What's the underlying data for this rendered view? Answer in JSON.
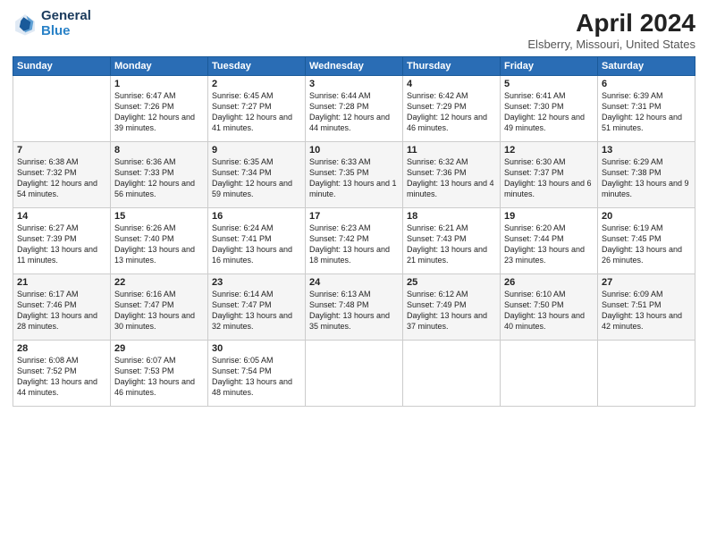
{
  "header": {
    "logo_line1": "General",
    "logo_line2": "Blue",
    "title": "April 2024",
    "location": "Elsberry, Missouri, United States"
  },
  "days_of_week": [
    "Sunday",
    "Monday",
    "Tuesday",
    "Wednesday",
    "Thursday",
    "Friday",
    "Saturday"
  ],
  "weeks": [
    [
      {
        "day": "",
        "sunrise": "",
        "sunset": "",
        "daylight": ""
      },
      {
        "day": "1",
        "sunrise": "Sunrise: 6:47 AM",
        "sunset": "Sunset: 7:26 PM",
        "daylight": "Daylight: 12 hours and 39 minutes."
      },
      {
        "day": "2",
        "sunrise": "Sunrise: 6:45 AM",
        "sunset": "Sunset: 7:27 PM",
        "daylight": "Daylight: 12 hours and 41 minutes."
      },
      {
        "day": "3",
        "sunrise": "Sunrise: 6:44 AM",
        "sunset": "Sunset: 7:28 PM",
        "daylight": "Daylight: 12 hours and 44 minutes."
      },
      {
        "day": "4",
        "sunrise": "Sunrise: 6:42 AM",
        "sunset": "Sunset: 7:29 PM",
        "daylight": "Daylight: 12 hours and 46 minutes."
      },
      {
        "day": "5",
        "sunrise": "Sunrise: 6:41 AM",
        "sunset": "Sunset: 7:30 PM",
        "daylight": "Daylight: 12 hours and 49 minutes."
      },
      {
        "day": "6",
        "sunrise": "Sunrise: 6:39 AM",
        "sunset": "Sunset: 7:31 PM",
        "daylight": "Daylight: 12 hours and 51 minutes."
      }
    ],
    [
      {
        "day": "7",
        "sunrise": "Sunrise: 6:38 AM",
        "sunset": "Sunset: 7:32 PM",
        "daylight": "Daylight: 12 hours and 54 minutes."
      },
      {
        "day": "8",
        "sunrise": "Sunrise: 6:36 AM",
        "sunset": "Sunset: 7:33 PM",
        "daylight": "Daylight: 12 hours and 56 minutes."
      },
      {
        "day": "9",
        "sunrise": "Sunrise: 6:35 AM",
        "sunset": "Sunset: 7:34 PM",
        "daylight": "Daylight: 12 hours and 59 minutes."
      },
      {
        "day": "10",
        "sunrise": "Sunrise: 6:33 AM",
        "sunset": "Sunset: 7:35 PM",
        "daylight": "Daylight: 13 hours and 1 minute."
      },
      {
        "day": "11",
        "sunrise": "Sunrise: 6:32 AM",
        "sunset": "Sunset: 7:36 PM",
        "daylight": "Daylight: 13 hours and 4 minutes."
      },
      {
        "day": "12",
        "sunrise": "Sunrise: 6:30 AM",
        "sunset": "Sunset: 7:37 PM",
        "daylight": "Daylight: 13 hours and 6 minutes."
      },
      {
        "day": "13",
        "sunrise": "Sunrise: 6:29 AM",
        "sunset": "Sunset: 7:38 PM",
        "daylight": "Daylight: 13 hours and 9 minutes."
      }
    ],
    [
      {
        "day": "14",
        "sunrise": "Sunrise: 6:27 AM",
        "sunset": "Sunset: 7:39 PM",
        "daylight": "Daylight: 13 hours and 11 minutes."
      },
      {
        "day": "15",
        "sunrise": "Sunrise: 6:26 AM",
        "sunset": "Sunset: 7:40 PM",
        "daylight": "Daylight: 13 hours and 13 minutes."
      },
      {
        "day": "16",
        "sunrise": "Sunrise: 6:24 AM",
        "sunset": "Sunset: 7:41 PM",
        "daylight": "Daylight: 13 hours and 16 minutes."
      },
      {
        "day": "17",
        "sunrise": "Sunrise: 6:23 AM",
        "sunset": "Sunset: 7:42 PM",
        "daylight": "Daylight: 13 hours and 18 minutes."
      },
      {
        "day": "18",
        "sunrise": "Sunrise: 6:21 AM",
        "sunset": "Sunset: 7:43 PM",
        "daylight": "Daylight: 13 hours and 21 minutes."
      },
      {
        "day": "19",
        "sunrise": "Sunrise: 6:20 AM",
        "sunset": "Sunset: 7:44 PM",
        "daylight": "Daylight: 13 hours and 23 minutes."
      },
      {
        "day": "20",
        "sunrise": "Sunrise: 6:19 AM",
        "sunset": "Sunset: 7:45 PM",
        "daylight": "Daylight: 13 hours and 26 minutes."
      }
    ],
    [
      {
        "day": "21",
        "sunrise": "Sunrise: 6:17 AM",
        "sunset": "Sunset: 7:46 PM",
        "daylight": "Daylight: 13 hours and 28 minutes."
      },
      {
        "day": "22",
        "sunrise": "Sunrise: 6:16 AM",
        "sunset": "Sunset: 7:47 PM",
        "daylight": "Daylight: 13 hours and 30 minutes."
      },
      {
        "day": "23",
        "sunrise": "Sunrise: 6:14 AM",
        "sunset": "Sunset: 7:47 PM",
        "daylight": "Daylight: 13 hours and 32 minutes."
      },
      {
        "day": "24",
        "sunrise": "Sunrise: 6:13 AM",
        "sunset": "Sunset: 7:48 PM",
        "daylight": "Daylight: 13 hours and 35 minutes."
      },
      {
        "day": "25",
        "sunrise": "Sunrise: 6:12 AM",
        "sunset": "Sunset: 7:49 PM",
        "daylight": "Daylight: 13 hours and 37 minutes."
      },
      {
        "day": "26",
        "sunrise": "Sunrise: 6:10 AM",
        "sunset": "Sunset: 7:50 PM",
        "daylight": "Daylight: 13 hours and 40 minutes."
      },
      {
        "day": "27",
        "sunrise": "Sunrise: 6:09 AM",
        "sunset": "Sunset: 7:51 PM",
        "daylight": "Daylight: 13 hours and 42 minutes."
      }
    ],
    [
      {
        "day": "28",
        "sunrise": "Sunrise: 6:08 AM",
        "sunset": "Sunset: 7:52 PM",
        "daylight": "Daylight: 13 hours and 44 minutes."
      },
      {
        "day": "29",
        "sunrise": "Sunrise: 6:07 AM",
        "sunset": "Sunset: 7:53 PM",
        "daylight": "Daylight: 13 hours and 46 minutes."
      },
      {
        "day": "30",
        "sunrise": "Sunrise: 6:05 AM",
        "sunset": "Sunset: 7:54 PM",
        "daylight": "Daylight: 13 hours and 48 minutes."
      },
      {
        "day": "",
        "sunrise": "",
        "sunset": "",
        "daylight": ""
      },
      {
        "day": "",
        "sunrise": "",
        "sunset": "",
        "daylight": ""
      },
      {
        "day": "",
        "sunrise": "",
        "sunset": "",
        "daylight": ""
      },
      {
        "day": "",
        "sunrise": "",
        "sunset": "",
        "daylight": ""
      }
    ]
  ]
}
